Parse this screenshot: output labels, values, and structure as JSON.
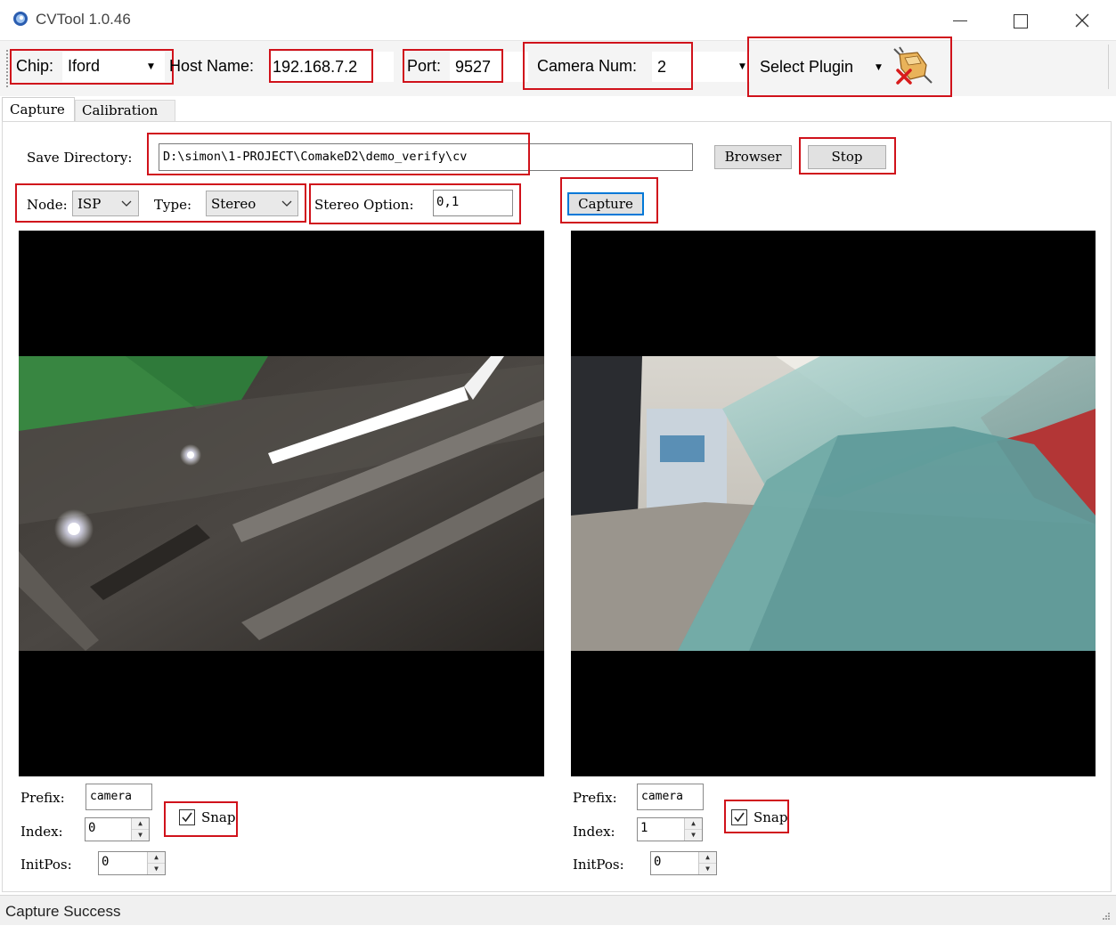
{
  "window": {
    "title": "CVTool 1.0.46",
    "icon": "app-logo-icon"
  },
  "toolbar": {
    "chip_label": "Chip:",
    "chip_value": "Iford",
    "host_label": "Host Name:",
    "host_value": "192.168.7.2",
    "port_label": "Port:",
    "port_value": "9527",
    "camera_num_label": "Camera Num:",
    "camera_num_value": "2",
    "plugin_label": "Select Plugin",
    "plugin_icon": "plugin-remove-icon"
  },
  "tabs": [
    {
      "label": "Capture",
      "active": true
    },
    {
      "label": "Calibration",
      "active": false
    }
  ],
  "capture": {
    "save_dir_label": "Save Directory:",
    "save_dir_value": "D:\\simon\\1-PROJECT\\ComakeD2\\demo_verify\\cv",
    "browser_label": "Browser",
    "stop_label": "Stop",
    "node_label": "Node:",
    "node_value": "ISP",
    "type_label": "Type:",
    "type_value": "Stereo",
    "stereo_option_label": "Stereo Option:",
    "stereo_option_value": "0,1",
    "capture_label": "Capture"
  },
  "cameras": [
    {
      "prefix_label": "Prefix:",
      "prefix_value": "camera",
      "index_label": "Index:",
      "index_value": "0",
      "initpos_label": "InitPos:",
      "initpos_value": "0",
      "snap_label": "Snap",
      "snap_checked": true
    },
    {
      "prefix_label": "Prefix:",
      "prefix_value": "camera",
      "index_label": "Index:",
      "index_value": "1",
      "initpos_label": "InitPos:",
      "initpos_value": "0",
      "snap_label": "Snap",
      "snap_checked": true
    }
  ],
  "status": {
    "text": "Capture Success"
  },
  "colors": {
    "highlight_box": "#d0121b",
    "accent": "#0078d7"
  }
}
